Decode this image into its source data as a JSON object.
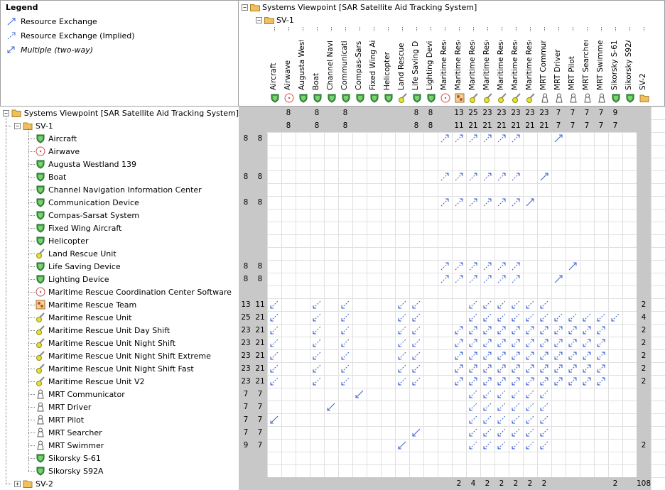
{
  "legend": {
    "title": "Legend",
    "items": [
      {
        "label": "Resource Exchange",
        "style": "normal",
        "icon": "resource-exchange-icon"
      },
      {
        "label": "Resource Exchange (Implied)",
        "style": "normal",
        "icon": "resource-exchange-implied-icon"
      },
      {
        "label": "Multiple (two-way)",
        "style": "italic",
        "icon": "multiple-two-way-icon"
      }
    ]
  },
  "header": {
    "root": "Systems Viewpoint [SAR Satellite Aid Tracking System]",
    "sub": "SV-1"
  },
  "columns": [
    "Aircraft",
    "Airwave",
    "Augusta Westland",
    "Boat",
    "Channel Navigation",
    "Communication Dev",
    "Compas-Sarsat Sys",
    "Fixed Wing Aircraft",
    "Helicopter",
    "Land Rescue Unit",
    "Life Saving Device",
    "Lighting Device",
    "Maritime Rescue Co",
    "Maritime Rescue Te",
    "Maritime Rescue Ur",
    "Maritime Rescue Ur",
    "Maritime Rescue Ur",
    "Maritime Rescue Ur",
    "Maritime Rescue Ur",
    "MRT Communicator",
    "MRT Driver",
    "MRT Pilot",
    "MRT Searcher",
    "MRT Swimmer",
    "Sikorsky S-61",
    "Sikorsky S92A",
    "SV-2"
  ],
  "column_types": [
    "system",
    "airwave",
    "system",
    "system",
    "system",
    "system",
    "system",
    "system",
    "system",
    "capability",
    "system",
    "system",
    "airwave",
    "team",
    "capability",
    "capability",
    "capability",
    "capability",
    "capability",
    "person",
    "person",
    "person",
    "person",
    "person",
    "system",
    "system",
    "folder"
  ],
  "column_totals_1": [
    "",
    "8",
    "",
    "8",
    "",
    "8",
    "",
    "",
    "",
    "",
    "8",
    "8",
    "",
    "13",
    "25",
    "23",
    "23",
    "23",
    "23",
    "23",
    "7",
    "7",
    "7",
    "7",
    "9",
    "",
    ""
  ],
  "column_totals_2": [
    "",
    "8",
    "",
    "8",
    "",
    "8",
    "",
    "",
    "",
    "",
    "8",
    "8",
    "",
    "11",
    "21",
    "21",
    "21",
    "21",
    "21",
    "21",
    "7",
    "7",
    "7",
    "7",
    "7",
    "",
    ""
  ],
  "tree": {
    "root": "Systems Viewpoint [SAR Satellite Aid Tracking System]",
    "sv1": "SV-1",
    "sv2": "SV-2"
  },
  "rows": [
    {
      "label": "Aircraft",
      "type": "system",
      "t1": "8",
      "t2": "8",
      "last": ""
    },
    {
      "label": "Airwave",
      "type": "airwave",
      "t1": "",
      "t2": "",
      "last": ""
    },
    {
      "label": "Augusta Westland 139",
      "type": "system",
      "t1": "",
      "t2": "",
      "last": ""
    },
    {
      "label": "Boat",
      "type": "system",
      "t1": "8",
      "t2": "8",
      "last": ""
    },
    {
      "label": "Channel Navigation Information Center",
      "type": "system",
      "t1": "",
      "t2": "",
      "last": ""
    },
    {
      "label": "Communication Device",
      "type": "system",
      "t1": "8",
      "t2": "8",
      "last": ""
    },
    {
      "label": "Compas-Sarsat System",
      "type": "system",
      "t1": "",
      "t2": "",
      "last": ""
    },
    {
      "label": "Fixed Wing Aircraft",
      "type": "system",
      "t1": "",
      "t2": "",
      "last": ""
    },
    {
      "label": "Helicopter",
      "type": "system",
      "t1": "",
      "t2": "",
      "last": ""
    },
    {
      "label": "Land Rescue Unit",
      "type": "capability",
      "t1": "",
      "t2": "",
      "last": ""
    },
    {
      "label": "Life Saving Device",
      "type": "system",
      "t1": "8",
      "t2": "8",
      "last": ""
    },
    {
      "label": "Lighting Device",
      "type": "system",
      "t1": "8",
      "t2": "8",
      "last": ""
    },
    {
      "label": "Maritime Rescue Coordination Center Software",
      "type": "airwave",
      "t1": "",
      "t2": "",
      "last": ""
    },
    {
      "label": "Maritime Rescue Team",
      "type": "team",
      "t1": "13",
      "t2": "11",
      "last": "2"
    },
    {
      "label": "Maritime Rescue Unit",
      "type": "capability",
      "t1": "25",
      "t2": "21",
      "last": "4"
    },
    {
      "label": "Maritime Rescue Unit Day Shift",
      "type": "capability",
      "t1": "23",
      "t2": "21",
      "last": "2"
    },
    {
      "label": "Maritime Rescue Unit Night Shift",
      "type": "capability",
      "t1": "23",
      "t2": "21",
      "last": "2"
    },
    {
      "label": "Maritime Rescue Unit Night Shift Extreme",
      "type": "capability",
      "t1": "23",
      "t2": "21",
      "last": "2"
    },
    {
      "label": "Maritime Rescue Unit Night Shift Fast",
      "type": "capability",
      "t1": "23",
      "t2": "21",
      "last": "2"
    },
    {
      "label": "Maritime Rescue Unit V2",
      "type": "capability",
      "t1": "23",
      "t2": "21",
      "last": "2"
    },
    {
      "label": "MRT Communicator",
      "type": "person",
      "t1": "7",
      "t2": "7",
      "last": ""
    },
    {
      "label": "MRT Driver",
      "type": "person",
      "t1": "7",
      "t2": "7",
      "last": ""
    },
    {
      "label": "MRT Pilot",
      "type": "person",
      "t1": "7",
      "t2": "7",
      "last": ""
    },
    {
      "label": "MRT Searcher",
      "type": "person",
      "t1": "7",
      "t2": "7",
      "last": ""
    },
    {
      "label": "MRT Swimmer",
      "type": "person",
      "t1": "9",
      "t2": "7",
      "last": "2"
    },
    {
      "label": "Sikorsky S-61",
      "type": "system",
      "t1": "",
      "t2": "",
      "last": ""
    },
    {
      "label": "Sikorsky S92A",
      "type": "system",
      "t1": "",
      "t2": "",
      "last": ""
    }
  ],
  "sv2_row_totals": [
    "",
    "",
    "",
    "",
    "",
    "",
    "",
    "",
    "",
    "",
    "",
    "",
    "",
    "2",
    "4",
    "2",
    "2",
    "2",
    "2",
    "2",
    "",
    "",
    "",
    "",
    "2",
    "",
    "108"
  ],
  "arrow_rows": [
    "..............iiiiii..I....",
    "...........................",
    "...........................",
    "..............iiiiii.I.....",
    "...........................",
    "..............iiiiiiI......",
    "...........................",
    "...........................",
    "...........................",
    "...........................",
    "..............iiiiii...I...",
    "..............iiiiii..I....",
    "...........................",
    "..d..d.d...dd...dddddd.....",
    "..d..d.d...dd...ddddddddddd",
    "..d..d.d...dd..mmmmmmmmmmm.",
    "..d..d.d...dd..mmmmmmmmmmm.",
    "..d..d.d...dd..mmmmmmmmmmm.",
    "..d..d.d...dd..mmmmmmmmmmm.",
    "..d..d.d...dd..mmmmmmmmmmm.",
    "........D.......dddddd.....",
    "......D.........dddddd.....",
    "..D.............dddddd.....",
    "............D...dddddd.....",
    "...........D....dddddd....."
  ]
}
